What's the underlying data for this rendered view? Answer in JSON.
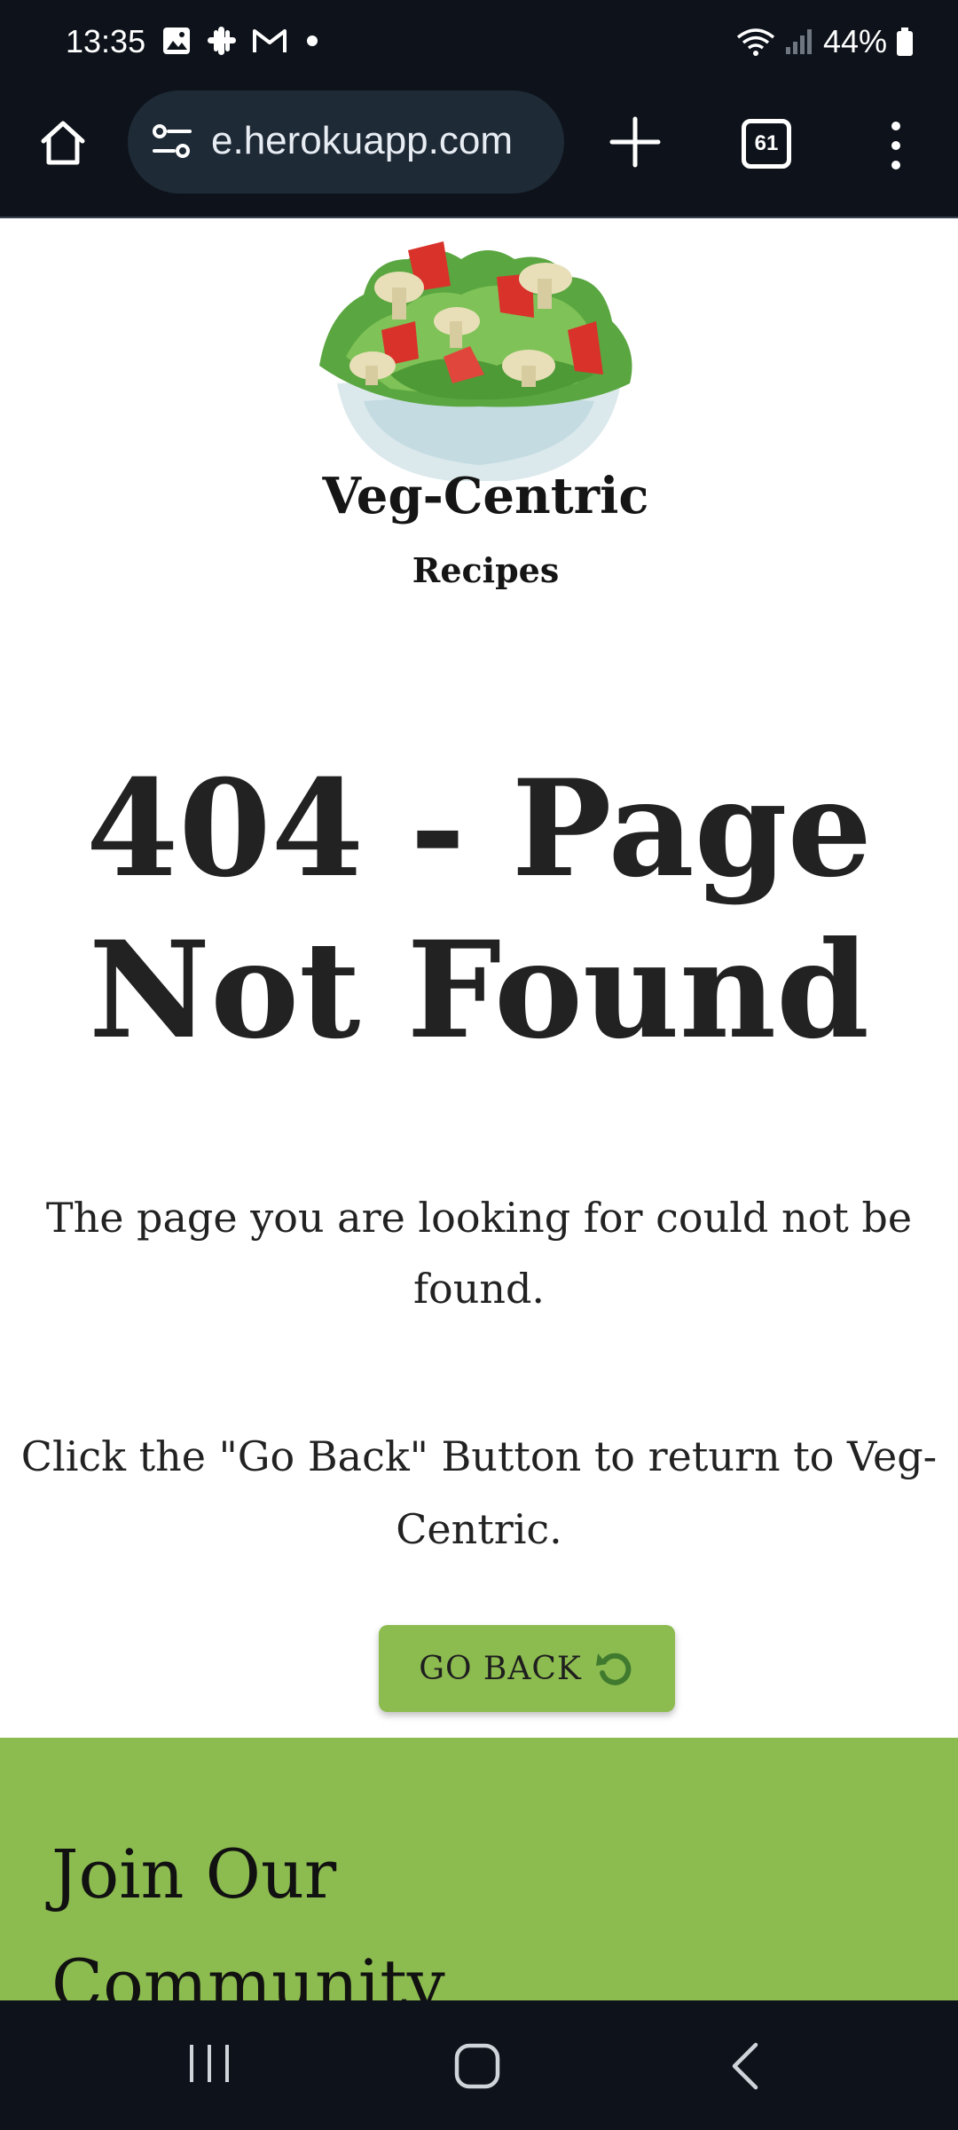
{
  "status_bar": {
    "time": "13:35",
    "battery": "44%"
  },
  "browser": {
    "url": "e.herokuapp.com",
    "tab_count": "61"
  },
  "brand": {
    "title": "Veg-Centric",
    "subtitle": "Recipes"
  },
  "error": {
    "title": "404 - Page Not Found",
    "message": "The page you are looking for could not be found.",
    "hint": "Click the \"Go Back\" Button to return to Veg-Centric.",
    "button_label": "GO BACK"
  },
  "footer": {
    "title": "Join Our Community"
  },
  "colors": {
    "accent_green": "#8cbb4f",
    "chrome_dark": "#0e131b"
  }
}
